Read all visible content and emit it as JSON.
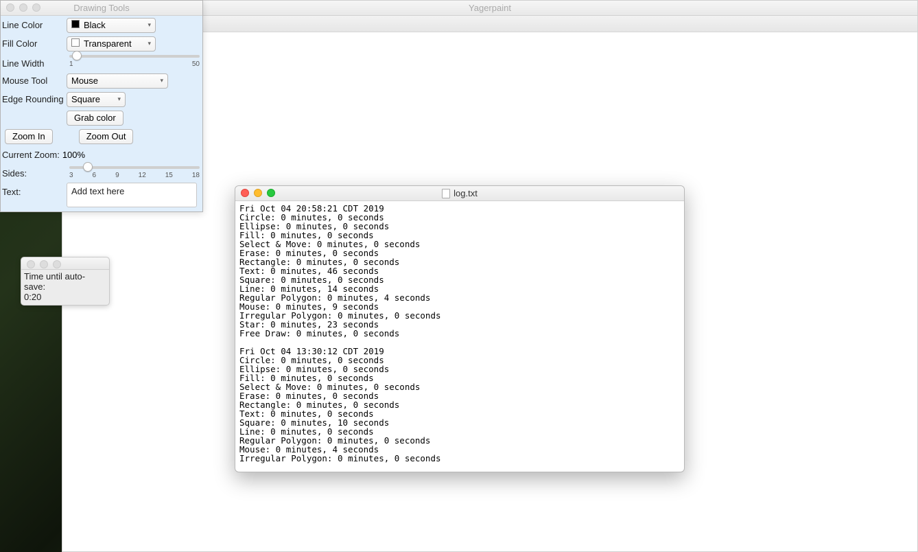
{
  "main": {
    "title": "Yagerpaint"
  },
  "tools": {
    "title": "Drawing Tools",
    "line_color_label": "Line Color",
    "line_color_value": "Black",
    "fill_color_label": "Fill Color",
    "fill_color_value": "Transparent",
    "line_width_label": "Line Width",
    "line_width_min": "1",
    "line_width_max": "50",
    "mouse_tool_label": "Mouse Tool",
    "mouse_tool_value": "Mouse",
    "edge_label": "Edge Rounding",
    "edge_value": "Square",
    "grab_color": "Grab color",
    "zoom_in": "Zoom In",
    "zoom_out": "Zoom Out",
    "current_zoom_label": "Current Zoom:",
    "current_zoom_value": "100%",
    "sides_label": "Sides:",
    "sides_ticks": [
      "3",
      "6",
      "9",
      "12",
      "15",
      "18"
    ],
    "text_label": "Text:",
    "text_value": "Add text here"
  },
  "autosave": {
    "label": "Time until auto-save:",
    "value": "0:20"
  },
  "log": {
    "title": "log.txt",
    "content": "Fri Oct 04 20:58:21 CDT 2019\nCircle: 0 minutes, 0 seconds\nEllipse: 0 minutes, 0 seconds\nFill: 0 minutes, 0 seconds\nSelect & Move: 0 minutes, 0 seconds\nErase: 0 minutes, 0 seconds\nRectangle: 0 minutes, 0 seconds\nText: 0 minutes, 46 seconds\nSquare: 0 minutes, 0 seconds\nLine: 0 minutes, 14 seconds\nRegular Polygon: 0 minutes, 4 seconds\nMouse: 0 minutes, 9 seconds\nIrregular Polygon: 0 minutes, 0 seconds\nStar: 0 minutes, 23 seconds\nFree Draw: 0 minutes, 0 seconds\n\nFri Oct 04 13:30:12 CDT 2019\nCircle: 0 minutes, 0 seconds\nEllipse: 0 minutes, 0 seconds\nFill: 0 minutes, 0 seconds\nSelect & Move: 0 minutes, 0 seconds\nErase: 0 minutes, 0 seconds\nRectangle: 0 minutes, 0 seconds\nText: 0 minutes, 0 seconds\nSquare: 0 minutes, 10 seconds\nLine: 0 minutes, 0 seconds\nRegular Polygon: 0 minutes, 0 seconds\nMouse: 0 minutes, 4 seconds\nIrregular Polygon: 0 minutes, 0 seconds"
  }
}
